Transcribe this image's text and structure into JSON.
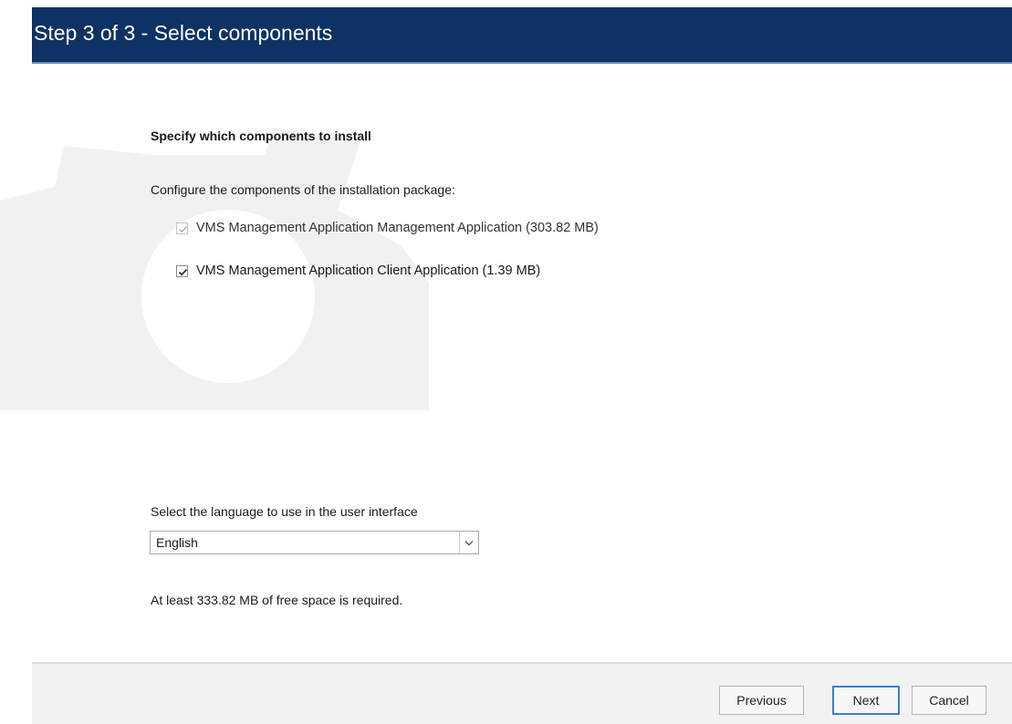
{
  "header": {
    "title": "Step 3 of 3 - Select components"
  },
  "main": {
    "section_title": "Specify which components to install",
    "config_label": "Configure the components of the installation package:",
    "components": [
      {
        "label": "VMS Management Application Management Application (303.82 MB)",
        "checked": true,
        "enabled": false
      },
      {
        "label": "VMS Management Application Client Application (1.39 MB)",
        "checked": true,
        "enabled": true
      }
    ],
    "language": {
      "label": "Select the language to use in the user interface",
      "selected": "English"
    },
    "space_note": "At least 333.82 MB of free space is required."
  },
  "footer": {
    "previous_label": "Previous",
    "next_label": "Next",
    "cancel_label": "Cancel"
  },
  "icons": {
    "background": "gear-icon",
    "checkmark": "checkmark-icon",
    "dropdown": "chevron-down-icon"
  },
  "colors": {
    "header_bg": "#0f3264",
    "header_text": "#ffffff",
    "footer_bg": "#f2f2f2",
    "focus_border": "#3a7fd1"
  }
}
